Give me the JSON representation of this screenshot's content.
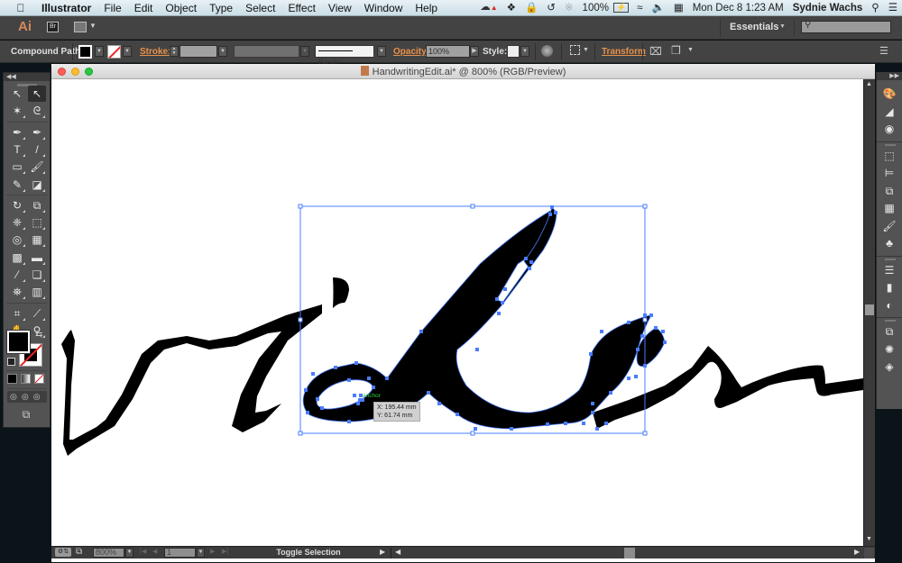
{
  "menubar": {
    "apple_icon": "apple-logo",
    "app_name": "Illustrator",
    "menus": [
      "File",
      "Edit",
      "Object",
      "Type",
      "Select",
      "Effect",
      "View",
      "Window",
      "Help"
    ],
    "status_icons": [
      "creative-cloud-icon",
      "dropbox-icon",
      "lock-icon",
      "time-machine-icon",
      "bluetooth-icon"
    ],
    "battery": "100%",
    "datetime": "Mon Dec 8  1:23 AM",
    "user": "Sydnie Wachs"
  },
  "appbar": {
    "logo": "Ai",
    "bridge": "Br",
    "workspace": "Essentials",
    "search_placeholder": ""
  },
  "controlbar": {
    "selection_type": "Compound Path",
    "fill_color": "#000000",
    "stroke_label": "Stroke:",
    "stroke_weight": "",
    "brush_profile": "Basic",
    "opacity_label": "Opacity:",
    "opacity_value": "100%",
    "style_label": "Style:",
    "transform_label": "Transform"
  },
  "document": {
    "title": "HandwritingEdit.ai* @ 800% (RGB/Preview)",
    "zoom": "800%",
    "artboard": "1",
    "status": "Toggle Selection"
  },
  "canvas": {
    "smart_guide_label": "anchor",
    "cursor_x": "X: 195.44 mm",
    "cursor_y": "Y: 61.74 mm",
    "selection_color": "#4a7cff"
  },
  "toolbox": {
    "tools": [
      {
        "name": "selection-tool",
        "glyph": "↖"
      },
      {
        "name": "direct-selection-tool",
        "glyph": "↖"
      },
      {
        "name": "magic-wand-tool",
        "glyph": "✶"
      },
      {
        "name": "lasso-tool",
        "glyph": "ᘓ"
      },
      {
        "name": "pen-tool",
        "glyph": "✒"
      },
      {
        "name": "curvature-tool",
        "glyph": "✒"
      },
      {
        "name": "type-tool",
        "glyph": "T"
      },
      {
        "name": "line-tool",
        "glyph": "/"
      },
      {
        "name": "rectangle-tool",
        "glyph": "▭"
      },
      {
        "name": "paintbrush-tool",
        "glyph": "🖌"
      },
      {
        "name": "pencil-tool",
        "glyph": "✎"
      },
      {
        "name": "eraser-tool",
        "glyph": "◪"
      },
      {
        "name": "rotate-tool",
        "glyph": "↻"
      },
      {
        "name": "scale-tool",
        "glyph": "⧉"
      },
      {
        "name": "warp-tool",
        "glyph": "❈"
      },
      {
        "name": "free-transform-tool",
        "glyph": "⬚"
      },
      {
        "name": "shape-builder-tool",
        "glyph": "◎"
      },
      {
        "name": "perspective-grid-tool",
        "glyph": "▦"
      },
      {
        "name": "mesh-tool",
        "glyph": "▩"
      },
      {
        "name": "gradient-tool",
        "glyph": "▬"
      },
      {
        "name": "eyedropper-tool",
        "glyph": "⁄"
      },
      {
        "name": "blend-tool",
        "glyph": "❏"
      },
      {
        "name": "symbol-sprayer-tool",
        "glyph": "⛯"
      },
      {
        "name": "column-graph-tool",
        "glyph": "▥"
      },
      {
        "name": "artboard-tool",
        "glyph": "⌗"
      },
      {
        "name": "slice-tool",
        "glyph": "⟋"
      },
      {
        "name": "hand-tool",
        "glyph": "✋"
      },
      {
        "name": "zoom-tool",
        "glyph": "⚲"
      }
    ]
  },
  "rightdock": {
    "panels": [
      {
        "name": "color-panel",
        "glyph": "🎨"
      },
      {
        "name": "color-guide-panel",
        "glyph": "◢"
      },
      {
        "name": "appearance-panel",
        "glyph": "◉"
      },
      {
        "name": "transform-panel",
        "glyph": "⬚"
      },
      {
        "name": "align-panel",
        "glyph": "⊨"
      },
      {
        "name": "pathfinder-panel",
        "glyph": "⧉"
      },
      {
        "name": "swatches-panel",
        "glyph": "▦"
      },
      {
        "name": "brushes-panel",
        "glyph": "🖌"
      },
      {
        "name": "symbols-panel",
        "glyph": "♣"
      },
      {
        "name": "stroke-panel",
        "glyph": "☰"
      },
      {
        "name": "gradient-panel",
        "glyph": "▮"
      },
      {
        "name": "transparency-panel",
        "glyph": "◐"
      },
      {
        "name": "artboards-panel",
        "glyph": "⧉"
      },
      {
        "name": "graphic-styles-panel",
        "glyph": "✺"
      },
      {
        "name": "layers-panel",
        "glyph": "◈"
      }
    ]
  }
}
